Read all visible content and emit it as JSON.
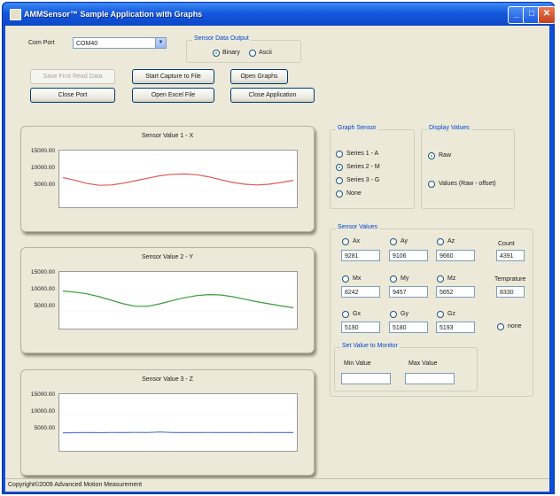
{
  "window": {
    "title": "AMMSensor™ Sample Application with Graphs"
  },
  "com_port": {
    "label": "Com Port",
    "value": "COM40"
  },
  "output": {
    "title": "Sensor Data Output",
    "options": [
      {
        "label": "Binary",
        "selected": true
      },
      {
        "label": "Ascii",
        "selected": false
      }
    ]
  },
  "buttons": {
    "save_first_read": "Save First Read Data",
    "start_capture": "Start Capture to File",
    "open_graphs": "Open Graphs",
    "close_port": "Close Port",
    "open_excel": "Open Excel File",
    "close_app": "Close Application"
  },
  "graph_sensor": {
    "title": "Graph Sensor",
    "options": [
      {
        "label": "Series 1 - A",
        "selected": false
      },
      {
        "label": "Series 2 - M",
        "selected": true
      },
      {
        "label": "Series 3 - G",
        "selected": false
      },
      {
        "label": "None",
        "selected": false
      }
    ]
  },
  "display_values": {
    "title": "Display Values",
    "options": [
      {
        "label": "Raw",
        "selected": true
      },
      {
        "label": "Values (Raw - offset)",
        "selected": false
      }
    ]
  },
  "sensor_values": {
    "title": "Sensor Values",
    "rows": [
      [
        {
          "label": "Ax",
          "value": "9281"
        },
        {
          "label": "Ay",
          "value": "9106"
        },
        {
          "label": "Az",
          "value": "9660"
        }
      ],
      [
        {
          "label": "Mx",
          "value": "8242"
        },
        {
          "label": "My",
          "value": "9457"
        },
        {
          "label": "Mz",
          "value": "5652"
        }
      ],
      [
        {
          "label": "Gx",
          "value": "5190"
        },
        {
          "label": "Gy",
          "value": "5180"
        },
        {
          "label": "Gz",
          "value": "5193"
        }
      ]
    ],
    "count_label": "Count",
    "count_value": "4391",
    "temp_label": "Temprature",
    "temp_value": "8330",
    "none_label": "none",
    "none_selected": false
  },
  "set_monitor": {
    "title": "Set Value to Monitor",
    "min_label": "Min Value",
    "max_label": "Max Value",
    "min_value": "",
    "max_value": ""
  },
  "chart_data": [
    {
      "type": "line",
      "title": "Sensor Value 1 - X",
      "ylim": [
        0,
        16000
      ],
      "yticks": [
        "15000.00",
        "10000.00",
        "5000.00"
      ],
      "series": [
        {
          "color": "#e05858",
          "values": [
            8400,
            7600,
            6700,
            6200,
            6300,
            6800,
            7500,
            8200,
            8900,
            9300,
            9400,
            9200,
            8600,
            7800,
            7000,
            6500,
            6300,
            6500,
            7000,
            7600
          ]
        }
      ]
    },
    {
      "type": "line",
      "title": "Sensor Value 2 - Y",
      "ylim": [
        0,
        16000
      ],
      "yticks": [
        "15000.00",
        "10000.00",
        "5000.00"
      ],
      "series": [
        {
          "color": "#3a9a3a",
          "values": [
            10600,
            10300,
            9800,
            9000,
            8000,
            7000,
            6300,
            6300,
            7000,
            7900,
            8700,
            9300,
            9600,
            9500,
            9000,
            8300,
            7600,
            7000,
            6400,
            5900
          ]
        }
      ]
    },
    {
      "type": "line",
      "title": "Sensor Value 3 - Z",
      "ylim": [
        0,
        16000
      ],
      "yticks": [
        "15000.00",
        "10000.00",
        "5000.00"
      ],
      "series": [
        {
          "color": "#5b7fd8",
          "values": [
            5100,
            5120,
            5160,
            5130,
            5180,
            5150,
            5200,
            5170,
            5320,
            5180,
            5150,
            5140,
            5170,
            5160,
            5140,
            5150,
            5170,
            5140,
            5150,
            5160
          ]
        }
      ]
    }
  ],
  "status": {
    "text": "Copyright©2009 Advanced Motion Measurement"
  }
}
